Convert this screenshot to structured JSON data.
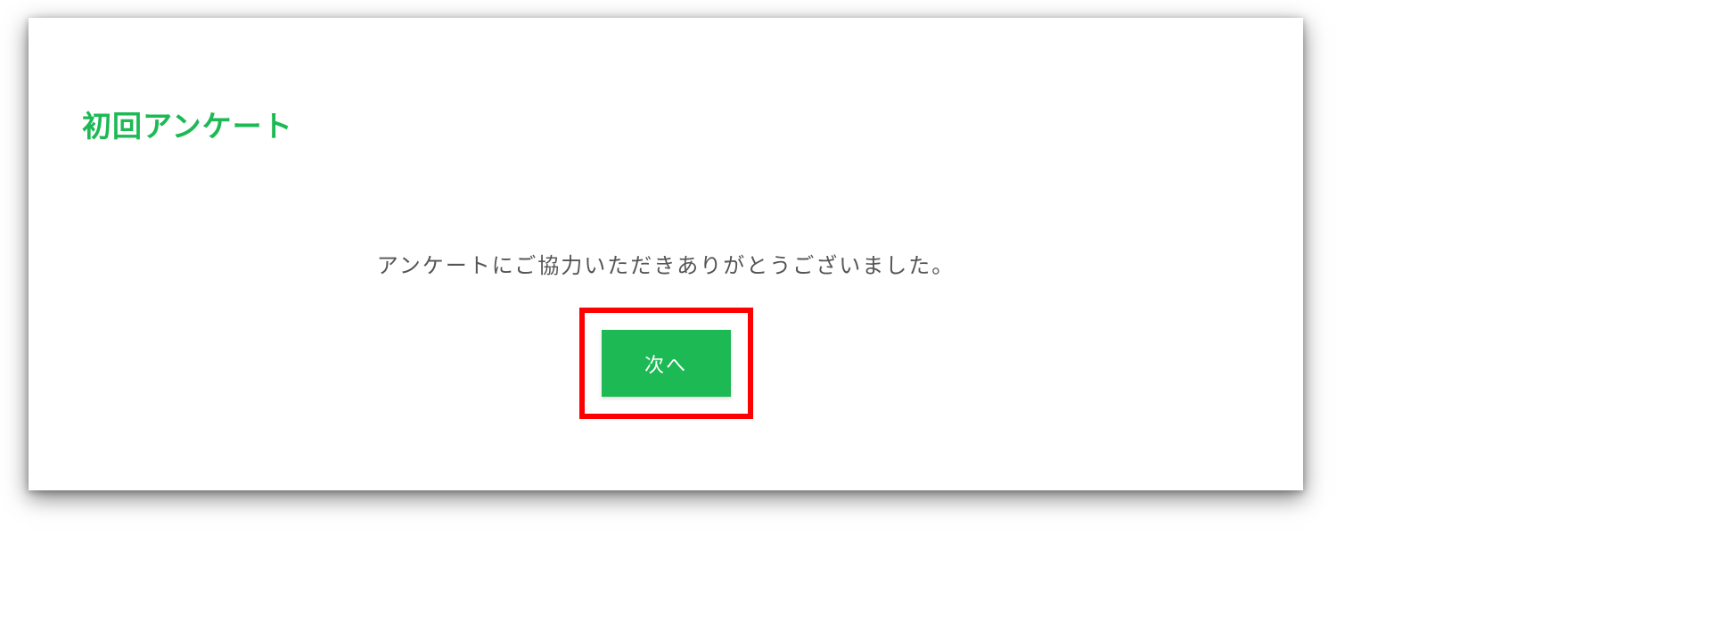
{
  "survey": {
    "title": "初回アンケート",
    "message": "アンケートにご協力いただきありがとうございました。",
    "next_button_label": "次へ"
  },
  "colors": {
    "accent": "#1db954",
    "highlight_border": "#ff0000"
  }
}
